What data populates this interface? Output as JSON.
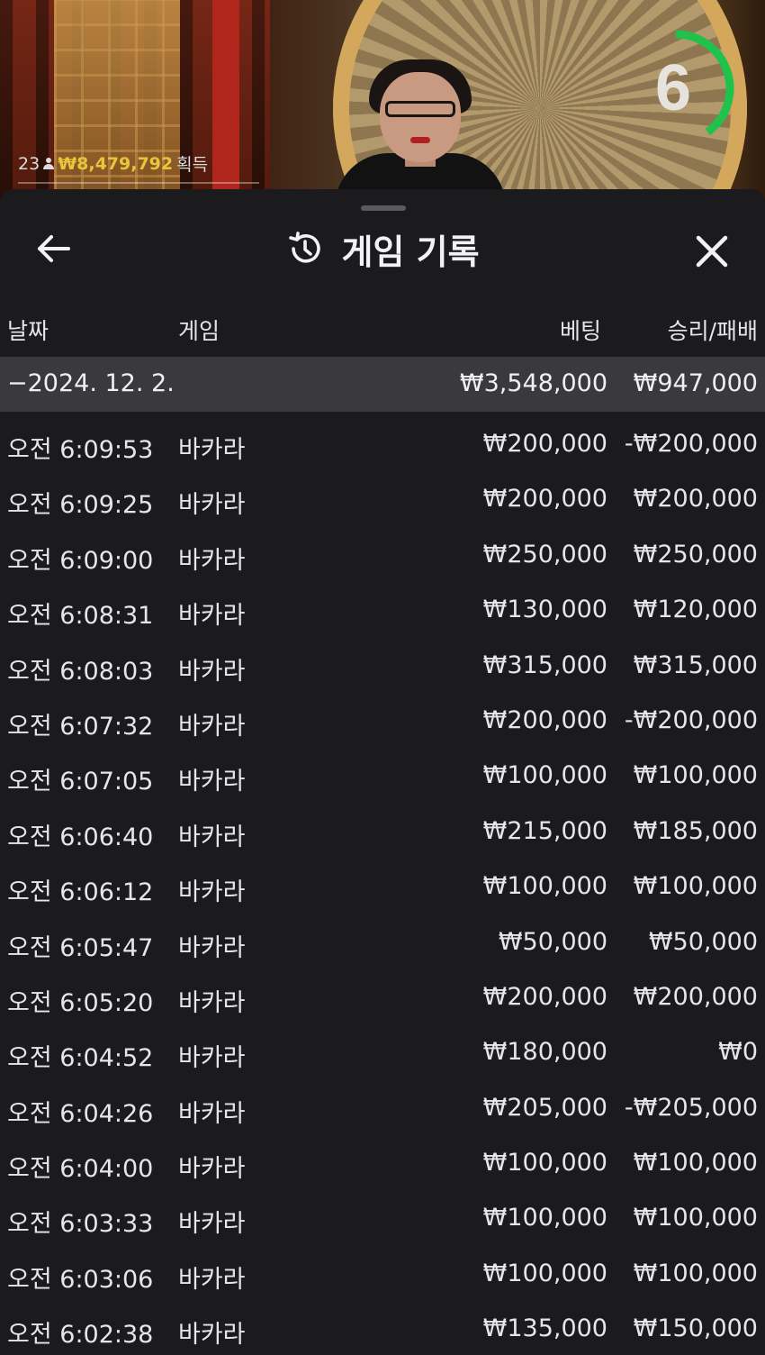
{
  "video": {
    "timer_value": "6",
    "timer_progress": 0.4,
    "player_count": "23",
    "win_amount": "₩8,479,792",
    "win_label": "획득"
  },
  "sheet": {
    "title": "게임 기록",
    "title_icon": "history-icon",
    "back_icon": "arrow-left-icon",
    "close_icon": "close-icon"
  },
  "columns": {
    "date": "날짜",
    "game": "게임",
    "bet": "베팅",
    "result": "승리/패배"
  },
  "date_group": {
    "label": "−2024. 12. 2.",
    "bet_total": "₩3,548,000",
    "result_total": "₩947,000"
  },
  "rows": [
    {
      "time": "오전 6:09:53",
      "game": "바카라",
      "bet": "₩200,000",
      "result": "-₩200,000"
    },
    {
      "time": "오전 6:09:25",
      "game": "바카라",
      "bet": "₩200,000",
      "result": "₩200,000"
    },
    {
      "time": "오전 6:09:00",
      "game": "바카라",
      "bet": "₩250,000",
      "result": "₩250,000"
    },
    {
      "time": "오전 6:08:31",
      "game": "바카라",
      "bet": "₩130,000",
      "result": "₩120,000"
    },
    {
      "time": "오전 6:08:03",
      "game": "바카라",
      "bet": "₩315,000",
      "result": "₩315,000"
    },
    {
      "time": "오전 6:07:32",
      "game": "바카라",
      "bet": "₩200,000",
      "result": "-₩200,000"
    },
    {
      "time": "오전 6:07:05",
      "game": "바카라",
      "bet": "₩100,000",
      "result": "₩100,000"
    },
    {
      "time": "오전 6:06:40",
      "game": "바카라",
      "bet": "₩215,000",
      "result": "₩185,000"
    },
    {
      "time": "오전 6:06:12",
      "game": "바카라",
      "bet": "₩100,000",
      "result": "₩100,000"
    },
    {
      "time": "오전 6:05:47",
      "game": "바카라",
      "bet": "₩50,000",
      "result": "₩50,000"
    },
    {
      "time": "오전 6:05:20",
      "game": "바카라",
      "bet": "₩200,000",
      "result": "₩200,000"
    },
    {
      "time": "오전 6:04:52",
      "game": "바카라",
      "bet": "₩180,000",
      "result": "₩0"
    },
    {
      "time": "오전 6:04:26",
      "game": "바카라",
      "bet": "₩205,000",
      "result": "-₩205,000"
    },
    {
      "time": "오전 6:04:00",
      "game": "바카라",
      "bet": "₩100,000",
      "result": "₩100,000"
    },
    {
      "time": "오전 6:03:33",
      "game": "바카라",
      "bet": "₩100,000",
      "result": "₩100,000"
    },
    {
      "time": "오전 6:03:06",
      "game": "바카라",
      "bet": "₩100,000",
      "result": "₩100,000"
    },
    {
      "time": "오전 6:02:38",
      "game": "바카라",
      "bet": "₩135,000",
      "result": "₩150,000"
    }
  ]
}
